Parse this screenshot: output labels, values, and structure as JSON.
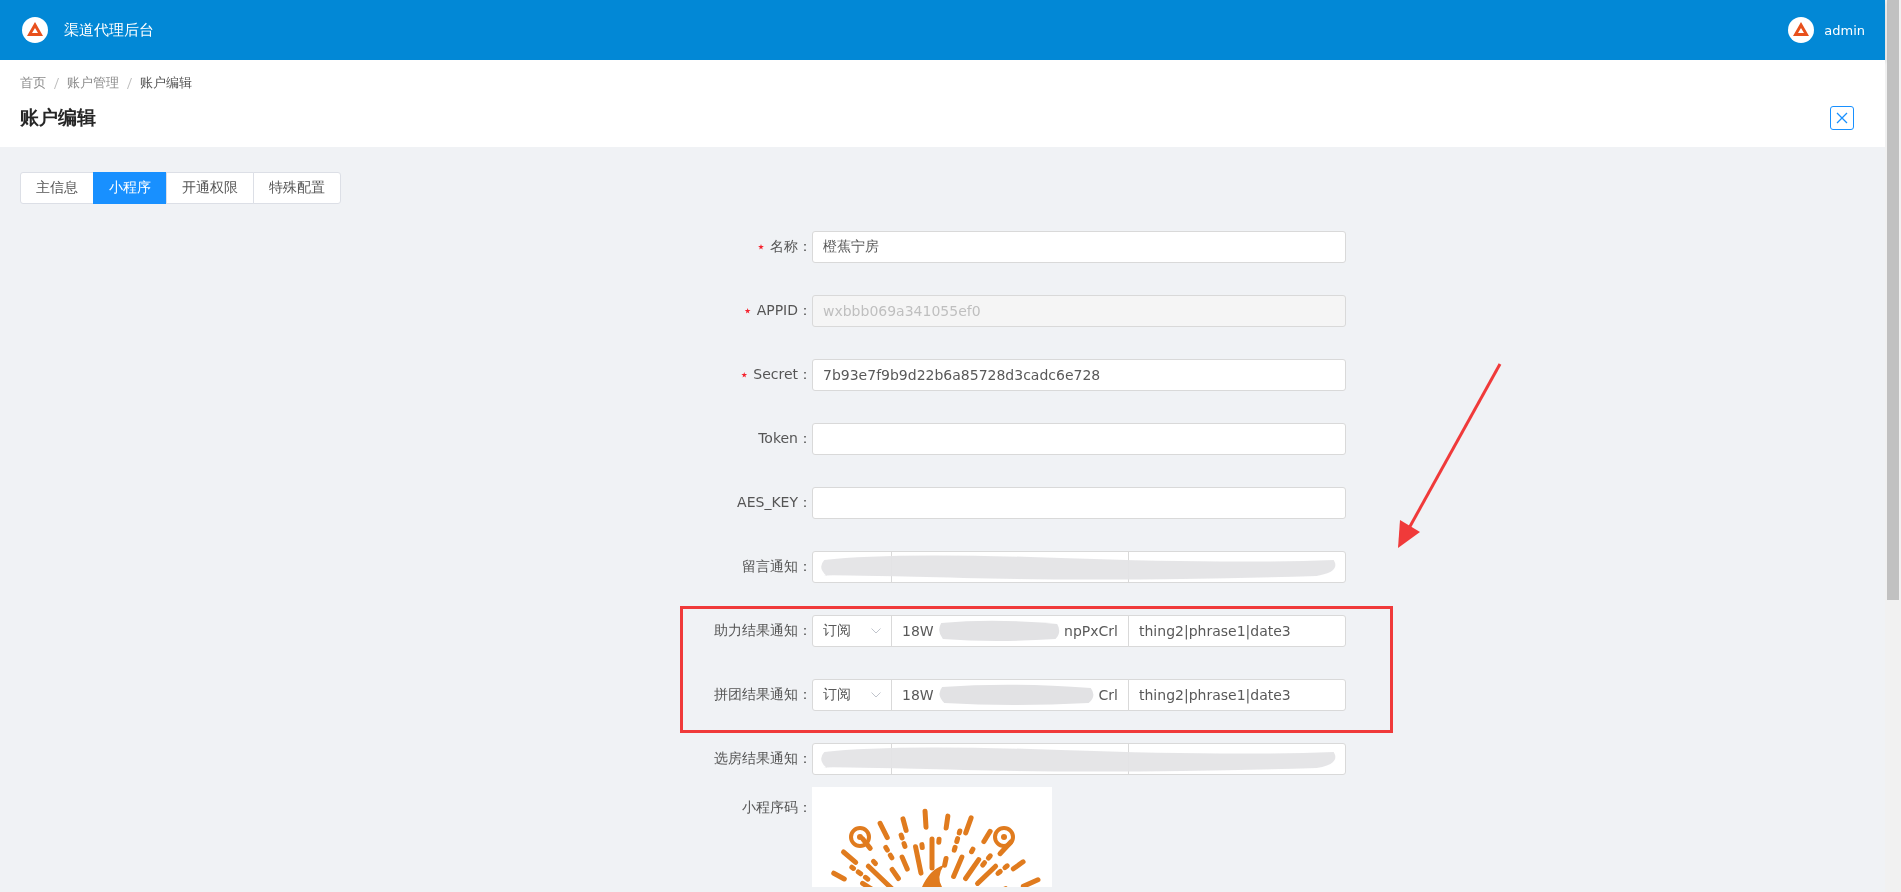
{
  "header": {
    "title": "渠道代理后台",
    "user": "admin"
  },
  "breadcrumb": [
    "首页",
    "账户管理",
    "账户编辑"
  ],
  "page_title": "账户编辑",
  "tabs": [
    {
      "label": "主信息",
      "selected": false
    },
    {
      "label": "小程序",
      "selected": true
    },
    {
      "label": "开通权限",
      "selected": false
    },
    {
      "label": "特殊配置",
      "selected": false
    }
  ],
  "form": {
    "fields": [
      {
        "kind": "text",
        "label": "名称：",
        "required": true,
        "value": "橙蕉宁房",
        "disabled": false
      },
      {
        "kind": "text",
        "label": "APPID：",
        "required": true,
        "value": "wxbbb069a341055ef0",
        "disabled": true
      },
      {
        "kind": "text",
        "label": "Secret：",
        "required": true,
        "value": "7b93e7f9b9d22b6a85728d3cadc6e728",
        "disabled": false
      },
      {
        "kind": "text",
        "label": "Token：",
        "required": false,
        "disabled": false
      },
      {
        "kind": "text",
        "label": "AES_KEY：",
        "required": false,
        "disabled": false
      },
      {
        "kind": "template",
        "label": "留言通知：",
        "redacted": true
      },
      {
        "kind": "template",
        "label": "助力结果通知：",
        "redacted": false,
        "type": "订阅",
        "template_id": [
          "18W",
          "npPxCrl"
        ],
        "keys": "thing2|phrase1|date3"
      },
      {
        "kind": "template",
        "label": "拼团结果通知：",
        "redacted": false,
        "type": "订阅",
        "template_id": [
          "18W",
          "Crl"
        ],
        "keys": "thing2|phrase1|date3"
      },
      {
        "kind": "template",
        "label": "选房结果通知：",
        "redacted": true
      },
      {
        "kind": "code",
        "label": "小程序码："
      }
    ]
  }
}
